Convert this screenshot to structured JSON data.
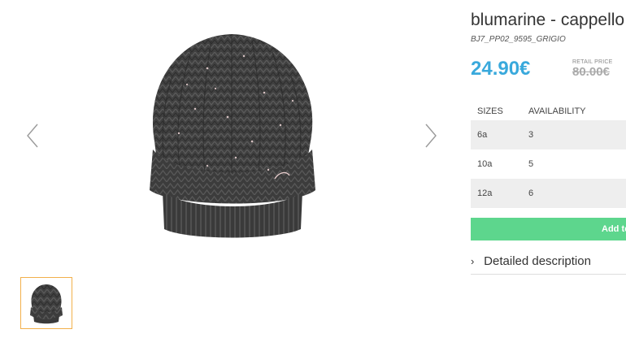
{
  "gallery": {
    "main_image": "knit-beanie-hat-grey",
    "prev_icon": "chevron-left-icon",
    "next_icon": "chevron-right-icon",
    "thumbnails": [
      "knit-beanie-hat-grey"
    ],
    "selected_thumb_border": "#f2b04b"
  },
  "product": {
    "title": "blumarine - cappello",
    "sku": "BJ7_PP02_9595_GRIGIO",
    "price": "24.90€",
    "retail_label": "RETAIL PRICE",
    "retail_price": "80.00€",
    "price_color": "#39a9dc"
  },
  "sizes_table": {
    "headers": {
      "size": "SIZES",
      "availability": "AVAILABILITY"
    },
    "rows": [
      {
        "size": "6a",
        "availability": "3"
      },
      {
        "size": "10a",
        "availability": "5"
      },
      {
        "size": "12a",
        "availability": "6"
      }
    ]
  },
  "add_to_cart": {
    "label": "Add to",
    "color": "#5dd68d"
  },
  "details": {
    "label": "Detailed description",
    "icon": "chevron-right-icon"
  }
}
